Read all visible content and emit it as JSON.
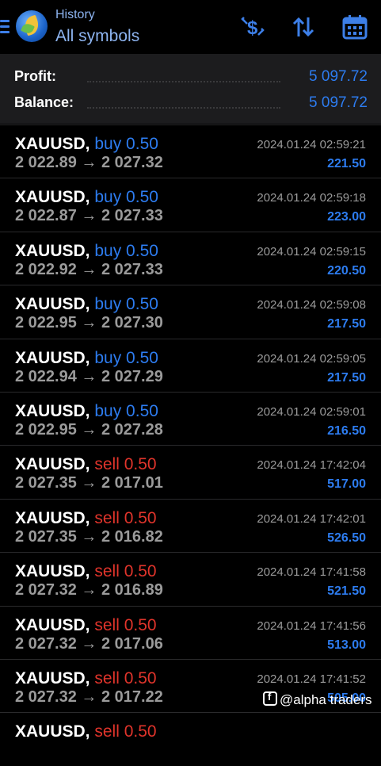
{
  "header": {
    "subtitle": "History",
    "title": "All symbols",
    "icons": [
      "menu-icon",
      "metatrader-logo-icon",
      "dollar-filter-icon",
      "sort-icon",
      "calendar-icon"
    ]
  },
  "summary": {
    "profit_label": "Profit:",
    "profit_value": "5 097.72",
    "balance_label": "Balance:",
    "balance_value": "5 097.72"
  },
  "trades": [
    {
      "symbol": "XAUUSD,",
      "side": "buy 0.50",
      "side_type": "buy",
      "prices": "2 022.89 → 2 027.32",
      "time": "2024.01.24 02:59:21",
      "profit": "221.50"
    },
    {
      "symbol": "XAUUSD,",
      "side": "buy 0.50",
      "side_type": "buy",
      "prices": "2 022.87 → 2 027.33",
      "time": "2024.01.24 02:59:18",
      "profit": "223.00"
    },
    {
      "symbol": "XAUUSD,",
      "side": "buy 0.50",
      "side_type": "buy",
      "prices": "2 022.92 → 2 027.33",
      "time": "2024.01.24 02:59:15",
      "profit": "220.50"
    },
    {
      "symbol": "XAUUSD,",
      "side": "buy 0.50",
      "side_type": "buy",
      "prices": "2 022.95 → 2 027.30",
      "time": "2024.01.24 02:59:08",
      "profit": "217.50"
    },
    {
      "symbol": "XAUUSD,",
      "side": "buy 0.50",
      "side_type": "buy",
      "prices": "2 022.94 → 2 027.29",
      "time": "2024.01.24 02:59:05",
      "profit": "217.50"
    },
    {
      "symbol": "XAUUSD,",
      "side": "buy 0.50",
      "side_type": "buy",
      "prices": "2 022.95 → 2 027.28",
      "time": "2024.01.24 02:59:01",
      "profit": "216.50"
    },
    {
      "symbol": "XAUUSD,",
      "side": "sell 0.50",
      "side_type": "sell",
      "prices": "2 027.35 → 2 017.01",
      "time": "2024.01.24 17:42:04",
      "profit": "517.00"
    },
    {
      "symbol": "XAUUSD,",
      "side": "sell 0.50",
      "side_type": "sell",
      "prices": "2 027.35 → 2 016.82",
      "time": "2024.01.24 17:42:01",
      "profit": "526.50"
    },
    {
      "symbol": "XAUUSD,",
      "side": "sell 0.50",
      "side_type": "sell",
      "prices": "2 027.32 → 2 016.89",
      "time": "2024.01.24 17:41:58",
      "profit": "521.50"
    },
    {
      "symbol": "XAUUSD,",
      "side": "sell 0.50",
      "side_type": "sell",
      "prices": "2 027.32 → 2 017.06",
      "time": "2024.01.24 17:41:56",
      "profit": "513.00"
    },
    {
      "symbol": "XAUUSD,",
      "side": "sell 0.50",
      "side_type": "sell",
      "prices": "2 027.32 → 2 017.22",
      "time": "2024.01.24 17:41:52",
      "profit": "505.00"
    },
    {
      "symbol": "XAUUSD,",
      "side": "sell 0.50",
      "side_type": "sell",
      "prices": "",
      "time": "",
      "profit": ""
    }
  ],
  "watermark": "@alpha traders",
  "colors": {
    "accent": "#2d7cf0",
    "sell": "#e0342b",
    "background": "#000000",
    "summary_bg": "#1c1c1e"
  }
}
